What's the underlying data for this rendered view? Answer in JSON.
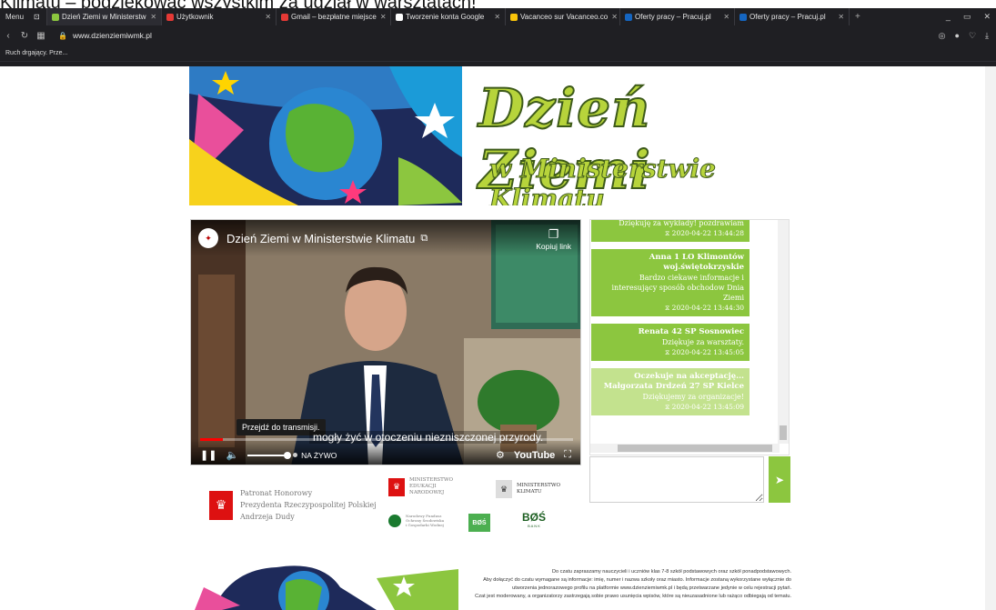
{
  "caption": "Klimatu – podziękować wszystkim za udział w warsztatach!",
  "browser": {
    "menu_label": "Menu",
    "tabs": [
      {
        "label": "Dzień Ziemi w Ministerstw",
        "active": true,
        "fav_color": "#8cc63f"
      },
      {
        "label": "Użytkownik",
        "active": false,
        "fav_color": "#e53935"
      },
      {
        "label": "Gmail – bezpłatne miejsce",
        "active": false,
        "fav_color": "#e53935"
      },
      {
        "label": "Tworzenie konta Google",
        "active": false,
        "fav_color": "#ffffff"
      },
      {
        "label": "Vacanceo sur Vacanceo.co",
        "active": false,
        "fav_color": "#f9c40a"
      },
      {
        "label": "Oferty pracy – Pracuj.pl",
        "active": false,
        "fav_color": "#1565c0"
      },
      {
        "label": "Oferty pracy – Pracuj.pl",
        "active": false,
        "fav_color": "#1565c0"
      }
    ],
    "url": "www.dzienziemiwmk.pl",
    "bookmark": "Ruch drgający. Prze..."
  },
  "banner": {
    "title": "Dzień Ziemi",
    "subtitle": "w Ministerstwie Klimatu"
  },
  "video": {
    "title": "Dzień Ziemi w Ministerstwie Klimatu",
    "copy_link": "Kopiuj link",
    "tooltip": "Przejdź do transmisji.",
    "subtitle": "mogły żyć w otoczeniu niezniszczonej przyrody.",
    "live_label": "NA ŻYWO",
    "youtube_label": "YouTube",
    "watermark": "Dzień Ziemi",
    "progress": 0.06
  },
  "chat": {
    "messages": [
      {
        "author": "",
        "text": "Dziękuję za wykłady! pozdrawiam",
        "time": "⧖ 2020-04-22 13:44:28",
        "pending": false
      },
      {
        "author": "Anna 1 LO Klimontów woj.świętokrzyskie",
        "text": "Bardzo ciekawe informacje i interesujący sposób obchodow Dnia Ziemi",
        "time": "⧖ 2020-04-22 13:44:30",
        "pending": false
      },
      {
        "author": "Renata 42 SP Sosnowiec",
        "text": "Dziękuje za warsztaty.",
        "time": "⧖ 2020-04-22 13:45:05",
        "pending": false
      },
      {
        "author": "Oczekuje na akceptację... Małgorzata Drdzeń 27 SP Kielce",
        "text": "Dziękujemy za organizacje!",
        "time": "⧖ 2020-04-22 13:45:09",
        "pending": true
      }
    ],
    "input_value": "",
    "send_icon": "send-icon"
  },
  "patrons": {
    "honorary": [
      "Patronat Honorowy",
      "Prezydenta Rzeczypospolitej Polskiej",
      "Andrzeja Dudy"
    ],
    "men": [
      "MINISTERSTWO",
      "EDUKACJI",
      "NARODOWEJ"
    ],
    "mk": [
      "MINISTERSTWO",
      "KLIMATU"
    ],
    "fund": [
      "Narodowy Fundusz",
      "Ochrony Środowiska",
      "i Gospodarki Wodnej"
    ],
    "bos_green": "BØŚ",
    "bos_bank": "BØŚ",
    "bos_bank_sub": "B A N K"
  },
  "info": [
    "Do czatu zapraszamy nauczycieli i uczniów klas 7-8 szkół podstawowych oraz szkół ponadpodstawowych.",
    "Aby dołączyć do czatu wymagane są informacje: imię, numer i nazwa szkoły oraz miasto. Informacje zostaną wykorzystane wyłącznie do",
    "utworzenia jednorazowego profilu na platformie www.dzienziemiwmk.pl i będą przetwarzane jedynie w celu rejestracji pytań.",
    "Czat jest moderowany, a organizatorzy zastrzegają sobie prawo usunięcia wpisów, które są nieuzasadnione lub rażąco odbiegają od tematu."
  ],
  "colors": {
    "accent_green": "#8cc63f",
    "pending_green": "#c3e28e",
    "browser_dark": "#1f1f23"
  }
}
